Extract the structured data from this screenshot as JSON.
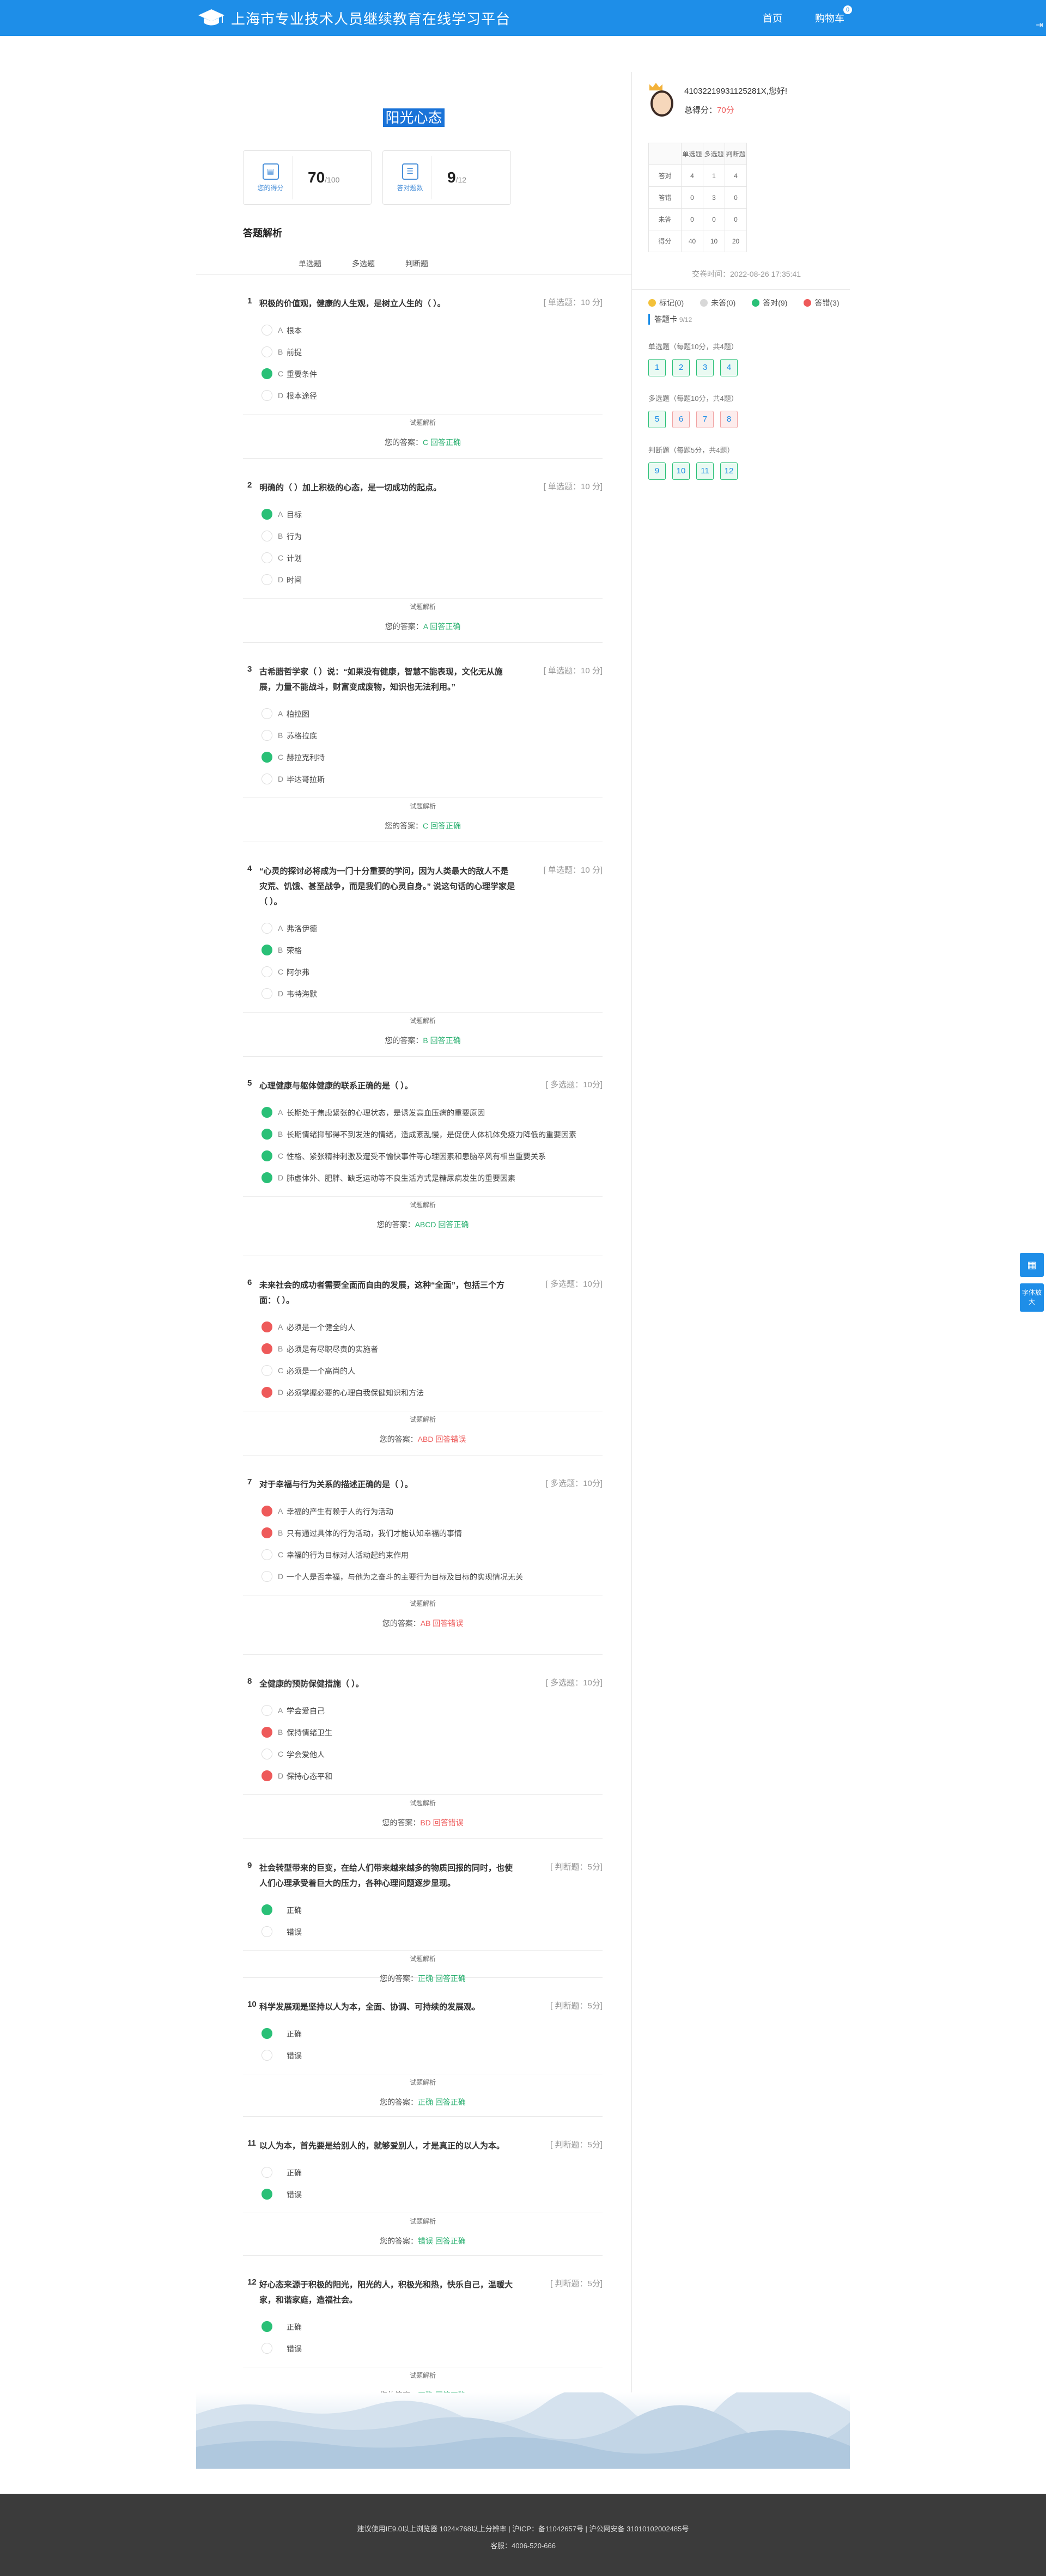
{
  "header": {
    "site_title": "上海市专业技术人员继续教育在线学习平台",
    "nav_home": "首页",
    "nav_cart": "购物车",
    "cart_badge": "0"
  },
  "exam": {
    "title": "阳光心态",
    "score_label": "您的得分",
    "score": "70",
    "score_total": "/100",
    "correct_label": "答对题数",
    "correct": "9",
    "correct_total": "/12",
    "section_title": "答题解析",
    "tabs": [
      "单选题",
      "多选题",
      "判断题"
    ],
    "analysis_label": "试题解析",
    "answer_prefix": "您的答案："
  },
  "questions": [
    {
      "no": "1",
      "text": "积极的价值观，健康的人生观，是树立人生的（ ）。",
      "type": "[ 单选题：10 分]",
      "options": [
        [
          "A",
          "根本",
          ""
        ],
        [
          "B",
          "前提",
          ""
        ],
        [
          "C",
          "重要条件",
          "green"
        ],
        [
          "D",
          "根本途径",
          ""
        ]
      ],
      "answer": "C",
      "result": "回答正确",
      "ok": true
    },
    {
      "no": "2",
      "text": "明确的（ ）加上积极的心态，是一切成功的起点。",
      "type": "[ 单选题：10 分]",
      "options": [
        [
          "A",
          "目标",
          "green"
        ],
        [
          "B",
          "行为",
          ""
        ],
        [
          "C",
          "计划",
          ""
        ],
        [
          "D",
          "时间",
          ""
        ]
      ],
      "answer": "A",
      "result": "回答正确",
      "ok": true
    },
    {
      "no": "3",
      "text": "古希腊哲学家（ ）说：“如果没有健康，智慧不能表现，文化无从施展，力量不能战斗，财富变成废物，知识也无法利用。”",
      "type": "[ 单选题：10 分]",
      "options": [
        [
          "A",
          "柏拉图",
          ""
        ],
        [
          "B",
          "苏格拉底",
          ""
        ],
        [
          "C",
          "赫拉克利特",
          "green"
        ],
        [
          "D",
          "毕达哥拉斯",
          ""
        ]
      ],
      "answer": "C",
      "result": "回答正确",
      "ok": true
    },
    {
      "no": "4",
      "text": "“心灵的探讨必将成为一门十分重要的学问，因为人类最大的敌人不是灾荒、饥饿、甚至战争，而是我们的心灵自身。” 说这句话的心理学家是（ ）。",
      "type": "[ 单选题：10 分]",
      "options": [
        [
          "A",
          "弗洛伊德",
          ""
        ],
        [
          "B",
          "荣格",
          "green"
        ],
        [
          "C",
          "阿尔弗",
          ""
        ],
        [
          "D",
          "韦特海默",
          ""
        ]
      ],
      "answer": "B",
      "result": "回答正确",
      "ok": true
    },
    {
      "no": "5",
      "text": "心理健康与躯体健康的联系正确的是（ ）。",
      "type": "[ 多选题：10分]",
      "options": [
        [
          "A",
          "长期处于焦虑紧张的心理状态，是诱发高血压病的重要原因",
          "green"
        ],
        [
          "B",
          "长期情绪抑郁得不到发泄的情绪，造成紊乱慢，是促使人体机体免疫力降低的重要因素",
          "green"
        ],
        [
          "C",
          "性格、紧张精神刺激及遭受不愉快事件等心理因素和患脑卒风有相当重要关系",
          "green"
        ],
        [
          "D",
          "肺虚体外、肥胖、缺乏运动等不良生活方式是糖尿病发生的重要因素",
          "green"
        ]
      ],
      "answer": "ABCD",
      "result": "回答正确",
      "ok": true
    },
    {
      "no": "6",
      "text": "未来社会的成功者需要全面而自由的发展，这种“全面”，包括三个方面：（ ）。",
      "type": "[ 多选题：10分]",
      "options": [
        [
          "A",
          "必须是一个健全的人",
          "red"
        ],
        [
          "B",
          "必须是有尽职尽责的实施者",
          "red"
        ],
        [
          "C",
          "必须是一个高尚的人",
          ""
        ],
        [
          "D",
          "必须掌握必要的心理自我保健知识和方法",
          "red"
        ]
      ],
      "answer": "ABD",
      "result": "回答错误",
      "ok": false
    },
    {
      "no": "7",
      "text": "对于幸福与行为关系的描述正确的是（ ）。",
      "type": "[ 多选题：10分]",
      "options": [
        [
          "A",
          "幸福的产生有赖于人的行为活动",
          "red"
        ],
        [
          "B",
          "只有通过具体的行为活动，我们才能认知幸福的事情",
          "red"
        ],
        [
          "C",
          "幸福的行为目标对人活动起约束作用",
          ""
        ],
        [
          "D",
          "一个人是否幸福，与他为之奋斗的主要行为目标及目标的实现情况无关",
          ""
        ]
      ],
      "answer": "AB",
      "result": "回答错误",
      "ok": false
    },
    {
      "no": "8",
      "text": "全健康的预防保健措施（ ）。",
      "type": "[ 多选题：10分]",
      "options": [
        [
          "A",
          "学会爱自己",
          ""
        ],
        [
          "B",
          "保持情绪卫生",
          "red"
        ],
        [
          "C",
          "学会爱他人",
          ""
        ],
        [
          "D",
          "保持心态平和",
          "red"
        ]
      ],
      "answer": "BD",
      "result": "回答错误",
      "ok": false
    },
    {
      "no": "9",
      "text": "社会转型带来的巨变，在给人们带来越来越多的物质回报的同时，也使人们心理承受着巨大的压力，各种心理问题逐步显现。",
      "type": "[ 判断题：5分]",
      "options": [
        [
          "",
          "正确",
          "green"
        ],
        [
          "",
          "错误",
          ""
        ]
      ],
      "answer": "正确",
      "result": "回答正确",
      "ok": true
    },
    {
      "no": "10",
      "text": "科学发展观是坚持以人为本，全面、协调、可持续的发展观。",
      "type": "[ 判断题：5分]",
      "options": [
        [
          "",
          "正确",
          "green"
        ],
        [
          "",
          "错误",
          ""
        ]
      ],
      "answer": "正确",
      "result": "回答正确",
      "ok": true
    },
    {
      "no": "11",
      "text": "以人为本，首先要是给别人的，就够爱别人，才是真正的以人为本。",
      "type": "[ 判断题：5分]",
      "options": [
        [
          "",
          "正确",
          ""
        ],
        [
          "",
          "错误",
          "green"
        ]
      ],
      "answer": "错误",
      "result": "回答正确",
      "ok": true
    },
    {
      "no": "12",
      "text": "好心态来源于积极的阳光，阳光的人，积极光和热，快乐自己，温暖大家，和谐家庭，造福社会。",
      "type": "[ 判断题：5分]",
      "options": [
        [
          "",
          "正确",
          "green"
        ],
        [
          "",
          "错误",
          ""
        ]
      ],
      "answer": "正确",
      "result": "回答正确",
      "ok": true
    }
  ],
  "side": {
    "user_id": "41032219931125281X,您好!",
    "score_label": "总得分：",
    "score_value": "70分",
    "table": [
      [
        "",
        "单选题",
        "多选题",
        "判断题"
      ],
      [
        "答对",
        "4",
        "1",
        "4"
      ],
      [
        "答错",
        "0",
        "3",
        "0"
      ],
      [
        "未答",
        "0",
        "0",
        "0"
      ],
      [
        "得分",
        "40",
        "10",
        "20"
      ]
    ],
    "commit_time": "交卷时间：2022-08-26 17:35:41",
    "legend": [
      {
        "label": "标记(0)",
        "color": "#f3c13a"
      },
      {
        "label": "未答(0)",
        "color": "#d8d8d8"
      },
      {
        "label": "答对(9)",
        "color": "#2ac077"
      },
      {
        "label": "答错(3)",
        "color": "#ee5a5a"
      }
    ],
    "card_title": "答题卡",
    "card_count": "9/12",
    "groups": [
      {
        "title": "单选题（每题10分，共4题）",
        "items": [
          [
            "1",
            ""
          ],
          [
            "2",
            ""
          ],
          [
            "3",
            ""
          ],
          [
            "4",
            ""
          ]
        ]
      },
      {
        "title": "多选题（每题10分，共4题）",
        "items": [
          [
            "5",
            ""
          ],
          [
            "6",
            "wrong"
          ],
          [
            "7",
            "wrong"
          ],
          [
            "8",
            "wrong"
          ]
        ]
      },
      {
        "title": "判断题（每题5分，共4题）",
        "items": [
          [
            "9",
            ""
          ],
          [
            "10",
            ""
          ],
          [
            "11",
            ""
          ],
          [
            "12",
            ""
          ]
        ]
      }
    ]
  },
  "float": {
    "qr": "扫码",
    "font": "字体放大"
  },
  "footer": {
    "line1": "建议使用IE9.0以上浏览器 1024×768以上分辨率 | 沪ICP：备11042657号 | 沪公网安备 31010102002485号",
    "line2": "客服：4006-520-666"
  }
}
